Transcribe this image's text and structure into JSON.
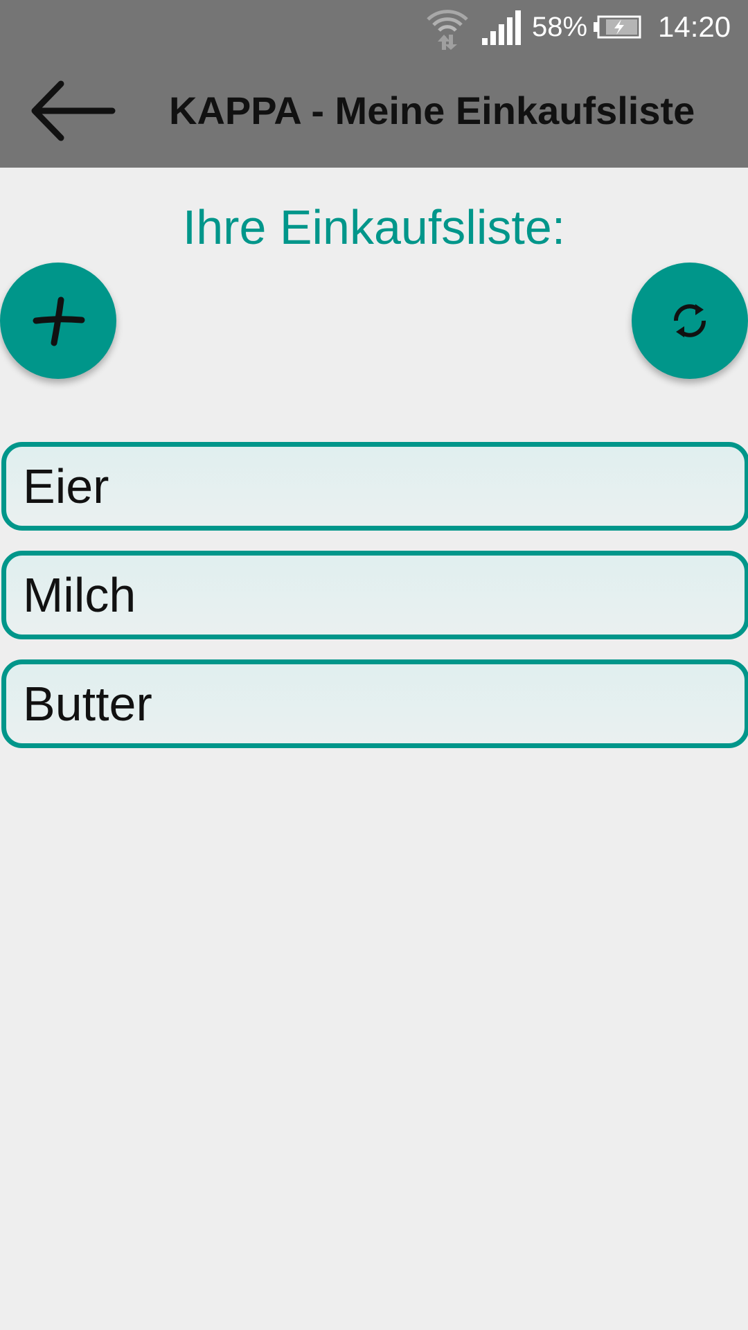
{
  "status_bar": {
    "battery_percent": "58%",
    "time": "14:20",
    "icons": [
      "wifi-icon",
      "signal-icon",
      "battery-charging-icon"
    ]
  },
  "app_bar": {
    "back_icon": "arrow-left-icon",
    "title": "KAPPA - Meine Einkaufsliste"
  },
  "main": {
    "heading": "Ihre Einkaufsliste:",
    "add_button_icon": "plus-icon",
    "refresh_button_icon": "refresh-icon",
    "items": [
      {
        "label": "Eier"
      },
      {
        "label": "Milch"
      },
      {
        "label": "Butter"
      }
    ]
  },
  "colors": {
    "accent": "#00968a",
    "app_bar": "#757575",
    "background": "#eeeeee"
  }
}
